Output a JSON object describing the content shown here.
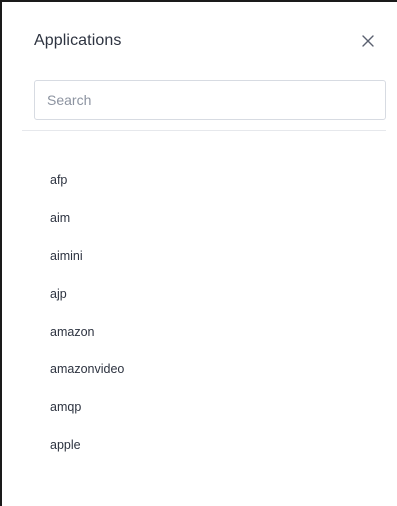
{
  "header": {
    "title": "Applications",
    "close_icon": "close-icon"
  },
  "search": {
    "placeholder": "Search",
    "value": ""
  },
  "applications": [
    "afp",
    "aim",
    "aimini",
    "ajp",
    "amazon",
    "amazonvideo",
    "amqp",
    "apple"
  ]
}
